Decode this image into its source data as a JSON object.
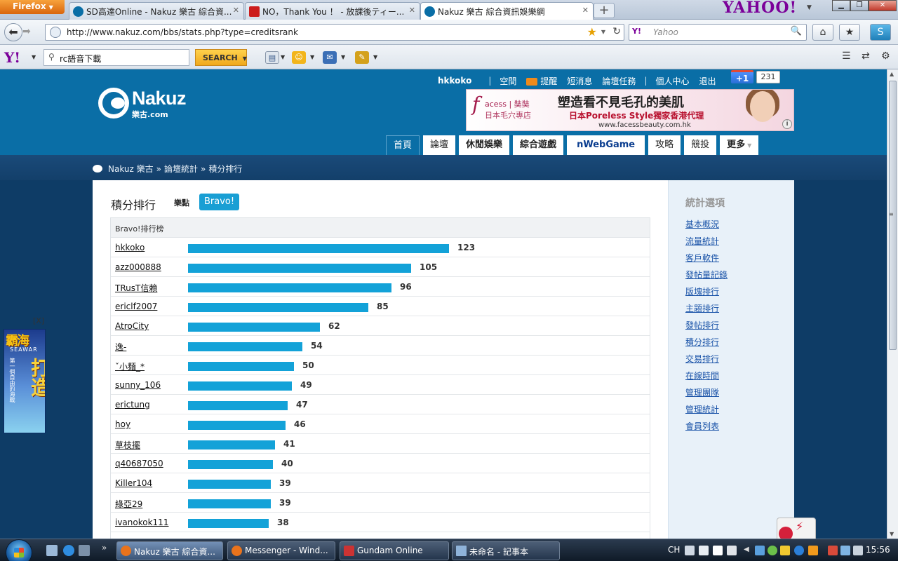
{
  "browser": {
    "firefox_button": "Firefox",
    "tabs": [
      {
        "title": "SD高達Online - Nakuz 樂古 綜合資..."
      },
      {
        "title": "NO，Thank You ！ - 放課後ティー..."
      },
      {
        "title": "Nakuz 樂古 綜合資訊娛樂網"
      }
    ],
    "yahoo_brand": "YAHOO!",
    "url": "http://www.nakuz.com/bbs/stats.php?type=creditsrank",
    "search_placeholder": "Yahoo",
    "search_engine_label": "Y!"
  },
  "yahoo_toolbar": {
    "logo": "Y!",
    "query": "rc語音下載",
    "search_button": "SEARCH"
  },
  "site": {
    "logo_name": "Nakuz",
    "logo_sub": "樂古.com",
    "user": {
      "username": "hkkoko",
      "sep": "|",
      "links": [
        "空間",
        "提醒",
        "短消息",
        "論壇任務"
      ],
      "links2": [
        "個人中心",
        "退出"
      ]
    },
    "plusone": {
      "label": "+1",
      "count": "231"
    },
    "ad": {
      "brand_glyph": "f",
      "brand_name": "acess | 奘奘",
      "brand_sub": "日本毛穴專店",
      "headline": "塑造看不見毛孔的美肌",
      "line2": "日本Poreless Style獨家香港代理",
      "site": "www.facessbeauty.com.hk",
      "info": "i"
    },
    "nav": [
      {
        "label": "首頁",
        "active": true
      },
      {
        "label": "論壇"
      },
      {
        "label": "休閒娛樂",
        "bold": true
      },
      {
        "label": "綜合遊戲",
        "bold": true
      },
      {
        "label": "nWebGame",
        "nweb": true
      },
      {
        "label": "攻略"
      },
      {
        "label": "競投"
      },
      {
        "label": "更多",
        "bold": true,
        "dropdown": true
      }
    ],
    "breadcrumb": [
      "Nakuz 樂古",
      "論壇統計",
      "積分排行"
    ],
    "breadcrumb_sep": "»"
  },
  "ranking": {
    "title": "積分排行",
    "tabs": [
      {
        "label": "樂點",
        "selected": false
      },
      {
        "label": "Bravo!",
        "selected": true
      }
    ],
    "table_header": "Bravo!排行榜",
    "max_value": 123,
    "rows": [
      {
        "name": "hkkoko",
        "value": 123
      },
      {
        "name": "azz000888",
        "value": 105
      },
      {
        "name": "TRusT信賴",
        "value": 96
      },
      {
        "name": "ericlf2007",
        "value": 85
      },
      {
        "name": "AtroCity",
        "value": 62
      },
      {
        "name": "逸-",
        "value": 54
      },
      {
        "name": "ˇ小麺_*",
        "value": 50
      },
      {
        "name": "sunny_106",
        "value": 49
      },
      {
        "name": "erictung",
        "value": 47
      },
      {
        "name": "hoy",
        "value": 46
      },
      {
        "name": "草枝擺",
        "value": 41
      },
      {
        "name": "q40687050",
        "value": 40
      },
      {
        "name": "Killer104",
        "value": 39
      },
      {
        "name": "綠亞29",
        "value": 39
      },
      {
        "name": "ivanokok111",
        "value": 38
      }
    ]
  },
  "sidebar": {
    "title": "統計選項",
    "links": [
      "基本概況",
      "流量統計",
      "客戶軟件",
      "發帖量記錄",
      "版塊排行",
      "主題排行",
      "發帖排行",
      "積分排行",
      "交易排行",
      "在線時間",
      "管理團隊",
      "管理統計",
      "會員列表"
    ]
  },
  "side_ad": {
    "title": "霸海",
    "subtitle": "SEAWAR",
    "big": "打造",
    "small": "第一個自由的海戰",
    "close": "[X]"
  },
  "taskbar": {
    "tasks": [
      {
        "title": "Nakuz 樂古 綜合資...",
        "active": true
      },
      {
        "title": "Messenger - Wind..."
      },
      {
        "title": "Gundam Online"
      },
      {
        "title": "未命名 - 記事本"
      }
    ],
    "quicklaunch_more": "»",
    "lang": "CH",
    "clock": "15:56"
  }
}
